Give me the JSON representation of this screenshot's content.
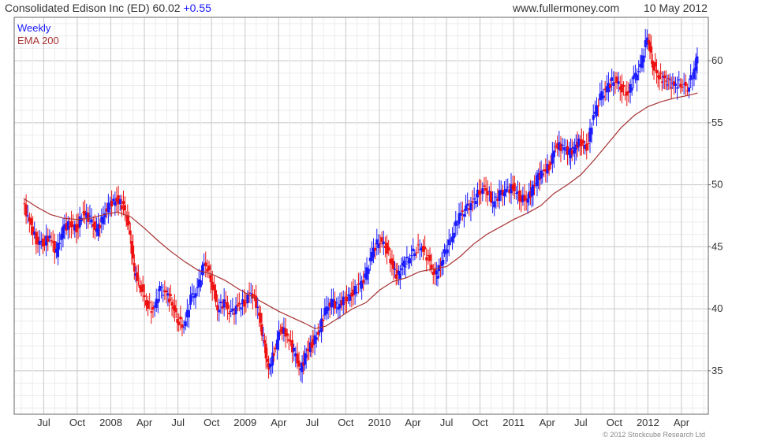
{
  "header": {
    "title": "Consolidated Edison Inc (ED) 60.02",
    "change": "+0.55",
    "site": "www.fullermoney.com",
    "date": "10 May 2012"
  },
  "legend": {
    "weekly": "Weekly",
    "ema": "EMA 200"
  },
  "footer": {
    "copyright": "© 2012 Stockcube Research Ltd"
  },
  "colors": {
    "up": "#1a1aff",
    "down": "#ee1111",
    "ema": "#a83232",
    "grid": "#dddddd",
    "frame": "#666666"
  },
  "chart_data": {
    "type": "line",
    "title": "Consolidated Edison Inc (ED) 60.02 +0.55",
    "xlabel": "",
    "ylabel": "",
    "ylim": [
      31.5,
      63.5
    ],
    "x_ticks": [
      {
        "label": "Jul",
        "t": 2007.5
      },
      {
        "label": "Oct",
        "t": 2007.75
      },
      {
        "label": "2008",
        "t": 2008.0
      },
      {
        "label": "Apr",
        "t": 2008.25
      },
      {
        "label": "Jul",
        "t": 2008.5
      },
      {
        "label": "Oct",
        "t": 2008.75
      },
      {
        "label": "2009",
        "t": 2009.0
      },
      {
        "label": "Apr",
        "t": 2009.25
      },
      {
        "label": "Jul",
        "t": 2009.5
      },
      {
        "label": "Oct",
        "t": 2009.75
      },
      {
        "label": "2010",
        "t": 2010.0
      },
      {
        "label": "Apr",
        "t": 2010.25
      },
      {
        "label": "Jul",
        "t": 2010.5
      },
      {
        "label": "Oct",
        "t": 2010.75
      },
      {
        "label": "2011",
        "t": 2011.0
      },
      {
        "label": "Apr",
        "t": 2011.25
      },
      {
        "label": "Jul",
        "t": 2011.5
      },
      {
        "label": "Oct",
        "t": 2011.75
      },
      {
        "label": "2012",
        "t": 2012.0
      },
      {
        "label": "Apr",
        "t": 2012.25
      }
    ],
    "y_ticks": [
      35,
      40,
      45,
      50,
      55,
      60
    ],
    "grid": true,
    "legend_position": "top-left",
    "series": [
      {
        "name": "Weekly",
        "style": "ohlc-bars",
        "points": [
          [
            2007.35,
            48.5
          ],
          [
            2007.4,
            47.0
          ],
          [
            2007.45,
            45.5
          ],
          [
            2007.5,
            45.3
          ],
          [
            2007.55,
            45.8
          ],
          [
            2007.6,
            44.5
          ],
          [
            2007.65,
            46.5
          ],
          [
            2007.7,
            46.8
          ],
          [
            2007.75,
            46.5
          ],
          [
            2007.8,
            47.8
          ],
          [
            2007.85,
            47.2
          ],
          [
            2007.9,
            46.2
          ],
          [
            2007.95,
            47.5
          ],
          [
            2008.0,
            48.5
          ],
          [
            2008.05,
            48.8
          ],
          [
            2008.1,
            48.2
          ],
          [
            2008.14,
            46.5
          ],
          [
            2008.18,
            43.0
          ],
          [
            2008.22,
            42.0
          ],
          [
            2008.27,
            40.5
          ],
          [
            2008.32,
            39.8
          ],
          [
            2008.37,
            41.5
          ],
          [
            2008.42,
            41.2
          ],
          [
            2008.46,
            40.5
          ],
          [
            2008.5,
            39.2
          ],
          [
            2008.55,
            38.5
          ],
          [
            2008.6,
            40.8
          ],
          [
            2008.65,
            41.5
          ],
          [
            2008.7,
            43.8
          ],
          [
            2008.75,
            42.5
          ],
          [
            2008.8,
            40.0
          ],
          [
            2008.85,
            40.5
          ],
          [
            2008.9,
            39.5
          ],
          [
            2008.95,
            40.2
          ],
          [
            2009.0,
            40.5
          ],
          [
            2009.05,
            41.5
          ],
          [
            2009.1,
            40.0
          ],
          [
            2009.14,
            37.5
          ],
          [
            2009.18,
            35.0
          ],
          [
            2009.22,
            36.5
          ],
          [
            2009.27,
            38.5
          ],
          [
            2009.32,
            37.8
          ],
          [
            2009.37,
            36.5
          ],
          [
            2009.42,
            35.0
          ],
          [
            2009.46,
            36.5
          ],
          [
            2009.5,
            37.2
          ],
          [
            2009.55,
            38.0
          ],
          [
            2009.6,
            39.8
          ],
          [
            2009.65,
            40.5
          ],
          [
            2009.7,
            40.2
          ],
          [
            2009.75,
            40.8
          ],
          [
            2009.8,
            41.2
          ],
          [
            2009.85,
            41.8
          ],
          [
            2009.9,
            42.5
          ],
          [
            2009.95,
            44.5
          ],
          [
            2010.0,
            45.5
          ],
          [
            2010.05,
            45.2
          ],
          [
            2010.1,
            43.5
          ],
          [
            2010.14,
            42.5
          ],
          [
            2010.18,
            43.5
          ],
          [
            2010.22,
            44.0
          ],
          [
            2010.27,
            44.8
          ],
          [
            2010.32,
            45.0
          ],
          [
            2010.37,
            44.0
          ],
          [
            2010.42,
            42.5
          ],
          [
            2010.46,
            43.5
          ],
          [
            2010.5,
            44.8
          ],
          [
            2010.55,
            46.0
          ],
          [
            2010.6,
            47.5
          ],
          [
            2010.65,
            48.0
          ],
          [
            2010.7,
            48.5
          ],
          [
            2010.75,
            49.5
          ],
          [
            2010.8,
            49.8
          ],
          [
            2010.85,
            48.5
          ],
          [
            2010.9,
            49.2
          ],
          [
            2010.95,
            49.5
          ],
          [
            2011.0,
            49.8
          ],
          [
            2011.05,
            49.0
          ],
          [
            2011.1,
            48.8
          ],
          [
            2011.14,
            49.5
          ],
          [
            2011.18,
            50.5
          ],
          [
            2011.22,
            51.0
          ],
          [
            2011.27,
            51.5
          ],
          [
            2011.32,
            53.2
          ],
          [
            2011.37,
            53.0
          ],
          [
            2011.42,
            52.5
          ],
          [
            2011.46,
            53.0
          ],
          [
            2011.5,
            53.5
          ],
          [
            2011.55,
            53.0
          ],
          [
            2011.6,
            55.5
          ],
          [
            2011.65,
            57.0
          ],
          [
            2011.7,
            57.8
          ],
          [
            2011.75,
            58.5
          ],
          [
            2011.8,
            58.0
          ],
          [
            2011.85,
            57.2
          ],
          [
            2011.9,
            58.5
          ],
          [
            2011.95,
            59.5
          ],
          [
            2012.0,
            62.0
          ],
          [
            2012.04,
            59.8
          ],
          [
            2012.08,
            58.8
          ],
          [
            2012.12,
            58.5
          ],
          [
            2012.16,
            58.2
          ],
          [
            2012.2,
            58.0
          ],
          [
            2012.25,
            58.2
          ],
          [
            2012.3,
            57.8
          ],
          [
            2012.35,
            59.2
          ],
          [
            2012.37,
            60.0
          ]
        ]
      },
      {
        "name": "EMA 200",
        "style": "line",
        "points": [
          [
            2007.35,
            48.9
          ],
          [
            2007.45,
            48.2
          ],
          [
            2007.55,
            47.6
          ],
          [
            2007.65,
            47.3
          ],
          [
            2007.75,
            47.2
          ],
          [
            2007.85,
            47.3
          ],
          [
            2007.95,
            47.6
          ],
          [
            2008.05,
            47.8
          ],
          [
            2008.15,
            47.4
          ],
          [
            2008.25,
            46.5
          ],
          [
            2008.35,
            45.5
          ],
          [
            2008.45,
            44.6
          ],
          [
            2008.55,
            43.8
          ],
          [
            2008.65,
            43.1
          ],
          [
            2008.75,
            42.8
          ],
          [
            2008.85,
            42.3
          ],
          [
            2008.95,
            41.6
          ],
          [
            2009.05,
            41.0
          ],
          [
            2009.15,
            40.4
          ],
          [
            2009.25,
            39.8
          ],
          [
            2009.35,
            39.3
          ],
          [
            2009.45,
            38.8
          ],
          [
            2009.52,
            38.4
          ],
          [
            2009.6,
            38.6
          ],
          [
            2009.7,
            39.3
          ],
          [
            2009.8,
            40.0
          ],
          [
            2009.9,
            40.5
          ],
          [
            2010.0,
            41.5
          ],
          [
            2010.1,
            42.2
          ],
          [
            2010.2,
            42.5
          ],
          [
            2010.3,
            43.0
          ],
          [
            2010.4,
            43.2
          ],
          [
            2010.5,
            43.4
          ],
          [
            2010.6,
            44.2
          ],
          [
            2010.7,
            45.2
          ],
          [
            2010.8,
            46.0
          ],
          [
            2010.9,
            46.6
          ],
          [
            2011.0,
            47.2
          ],
          [
            2011.1,
            47.7
          ],
          [
            2011.2,
            48.3
          ],
          [
            2011.3,
            49.3
          ],
          [
            2011.4,
            50.0
          ],
          [
            2011.5,
            50.8
          ],
          [
            2011.6,
            52.0
          ],
          [
            2011.7,
            53.3
          ],
          [
            2011.8,
            54.6
          ],
          [
            2011.9,
            55.6
          ],
          [
            2012.0,
            56.3
          ],
          [
            2012.1,
            56.7
          ],
          [
            2012.2,
            57.0
          ],
          [
            2012.3,
            57.2
          ],
          [
            2012.37,
            57.4
          ]
        ]
      }
    ]
  }
}
